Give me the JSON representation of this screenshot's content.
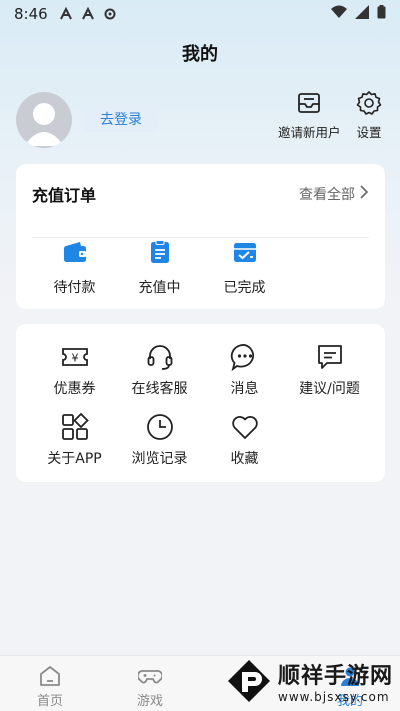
{
  "status_bar": {
    "time": "8:46"
  },
  "header": {
    "title": "我的"
  },
  "profile": {
    "login_label": "去登录",
    "invite_label": "邀请新用户",
    "settings_label": "设置"
  },
  "orders": {
    "title": "充值订单",
    "view_all_label": "查看全部",
    "items": [
      {
        "label": "待付款",
        "icon": "wallet-icon"
      },
      {
        "label": "充值中",
        "icon": "clipboard-icon"
      },
      {
        "label": "已完成",
        "icon": "completed-icon"
      }
    ]
  },
  "services": {
    "items": [
      {
        "label": "优惠券",
        "icon": "coupon-icon"
      },
      {
        "label": "在线客服",
        "icon": "headset-icon"
      },
      {
        "label": "消息",
        "icon": "chat-icon"
      },
      {
        "label": "建议/问题",
        "icon": "feedback-icon"
      },
      {
        "label": "关于APP",
        "icon": "apps-icon"
      },
      {
        "label": "浏览记录",
        "icon": "clock-icon"
      },
      {
        "label": "收藏",
        "icon": "heart-icon"
      }
    ]
  },
  "tabbar": {
    "items": [
      {
        "label": "首页",
        "icon": "home-icon"
      },
      {
        "label": "游戏",
        "icon": "gamepad-icon"
      },
      {
        "label": "",
        "icon": "unknown-icon"
      },
      {
        "label": "我的",
        "icon": "profile-icon"
      }
    ]
  },
  "watermark": {
    "text": "顺祥手游网",
    "url": "www.bjsxsy.com"
  },
  "colors": {
    "accent": "#2a7fd8",
    "icon_blue": "#1f86e6",
    "background": "#f2f3f6"
  }
}
